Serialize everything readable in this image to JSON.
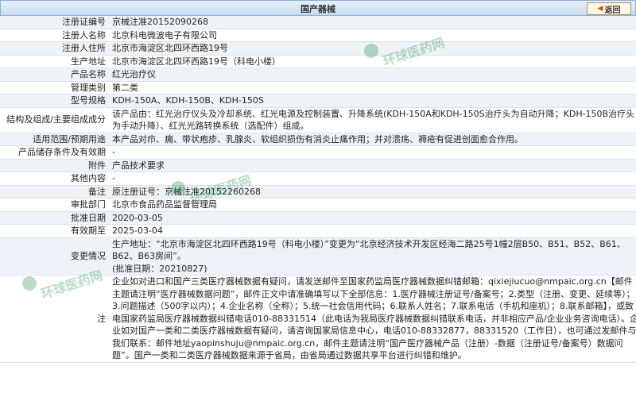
{
  "header": {
    "title": "国产器械",
    "back_label": "返回"
  },
  "watermark": {
    "text": "环球医药网",
    "color": "#1b8a4a"
  },
  "rows": [
    {
      "label": "注册证编号",
      "value": "京械注准20152090268"
    },
    {
      "label": "注册人名称",
      "value": "北京科电微波电子有限公司"
    },
    {
      "label": "注册人住所",
      "value": "北京市海淀区北四环西路19号"
    },
    {
      "label": "生产地址",
      "value": "北京市海淀区北四环西路19号（科电小楼）"
    },
    {
      "label": "产品名称",
      "value": "红光治疗仪"
    },
    {
      "label": "管理类别",
      "value": "第二类"
    },
    {
      "label": "型号规格",
      "value": "KDH-150A、KDH-150B、KDH-150S"
    },
    {
      "label": "结构及组成/主要组成成分",
      "value": "该产品由：红光治疗仪头及冷却系统、红光电源及控制装置、升降系统(KDH-150A和KDH-150S治疗头为自动升降；KDH-150B治疗头为手动升降）、红光光路转换系统（选配件）组成。"
    },
    {
      "label": "适用范围/预期用途",
      "value": "本产品对疖、痈、带状疱疹、乳腺炎、软组织损伤有消炎止痛作用；并对溃疡、褥疮有促进创面愈合作用。"
    },
    {
      "label": "产品储存条件及有效期",
      "value": "-"
    },
    {
      "label": "附件",
      "value": "产品技术要求"
    },
    {
      "label": "其他内容",
      "value": "-"
    },
    {
      "label": "备注",
      "value": "原注册证号：京械注准20152260268"
    },
    {
      "label": "审批部门",
      "value": "北京市食品药品监督管理局"
    },
    {
      "label": "批准日期",
      "value": "2020-03-05"
    },
    {
      "label": "有效期至",
      "value": "2025-03-04"
    },
    {
      "label": "变更情况",
      "value": "生产地址：“北京市海淀区北四环西路19号（科电小楼）”变更为“北京经济技术开发区经海二路25号1幢2层B50、B51、B52、B61、B62、B63房间”。\n(批准日期：20210827)"
    },
    {
      "label": "注",
      "value": "企业如对进口和国产三类医疗器械数据有疑问，请发送邮件至国家药监局医疗器械数据纠错邮箱：qixiejiucuo@nmpaic.org.cn【邮件主题请注明“医疗器械数据问题”，邮件正文中请准确填写以下全部信息：1.医疗器械注册证号/备案号；2.类型（注册、变更、延续等）；3.问题描述（500字以内）；4.企业名称（全称）；5.统一社会信用代码；6.联系人姓名；7.联系电话（手机和座机）；8.联系邮箱】，或致电国家药监局医疗器械数据纠错电话010-88331514（此电话为我局医疗器械数据纠错联系电话，并非相应产品/企业业务咨询电话）。企业如对国产一类和二类医疗器械数据有疑问，请咨询国家局信息中心，电话010-88332877，88331520（工作日），也可通过发邮件与我们联系：邮件地址yaopinshuju@nmpaic.org.cn，邮件主题请注明“国产医疗器械产品（注册）-数据（注册证号/备案号）数据问题”。国产一类和二类医疗器械数据来源于省局，由省局通过数据共享平台进行纠错和维护。"
    }
  ]
}
